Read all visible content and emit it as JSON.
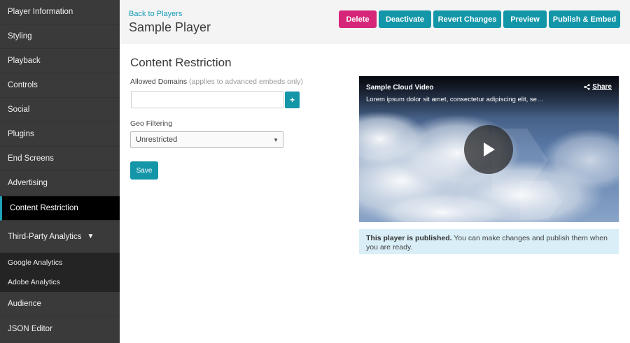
{
  "sidebar": {
    "items": [
      {
        "label": "Player Information"
      },
      {
        "label": "Styling"
      },
      {
        "label": "Playback"
      },
      {
        "label": "Controls"
      },
      {
        "label": "Social"
      },
      {
        "label": "Plugins"
      },
      {
        "label": "End Screens"
      },
      {
        "label": "Advertising"
      },
      {
        "label": "Content Restriction",
        "active": true
      },
      {
        "label": "Third-Party Analytics",
        "expanded": true,
        "caret": "▼"
      }
    ],
    "subitems": [
      {
        "label": "Google Analytics"
      },
      {
        "label": "Adobe Analytics"
      }
    ],
    "bottom_items": [
      {
        "label": "Audience"
      },
      {
        "label": "JSON Editor"
      }
    ]
  },
  "header": {
    "back_link": "Back to Players",
    "title": "Sample Player",
    "buttons": {
      "delete": "Delete",
      "deactivate": "Deactivate",
      "revert": "Revert Changes",
      "preview": "Preview",
      "publish": "Publish & Embed"
    }
  },
  "main": {
    "section_title": "Content Restriction",
    "allowed_domains": {
      "label": "Allowed Domains",
      "hint": "(applies to advanced embeds only)",
      "value": "",
      "add_label": "+"
    },
    "geo_filtering": {
      "label": "Geo Filtering",
      "selected": "Unrestricted"
    },
    "save_label": "Save"
  },
  "video": {
    "title": "Sample Cloud Video",
    "description": "Lorem ipsum dolor sit amet, consectetur adipiscing elit, se…",
    "share_label": "Share"
  },
  "notice": {
    "bold": "This player is published.",
    "text": " You can make changes and publish them when you are ready."
  },
  "colors": {
    "accent": "#1496a9",
    "danger": "#d5267a",
    "sidebar_bg": "#3a3a3a",
    "notice_bg": "#d9eef7"
  }
}
